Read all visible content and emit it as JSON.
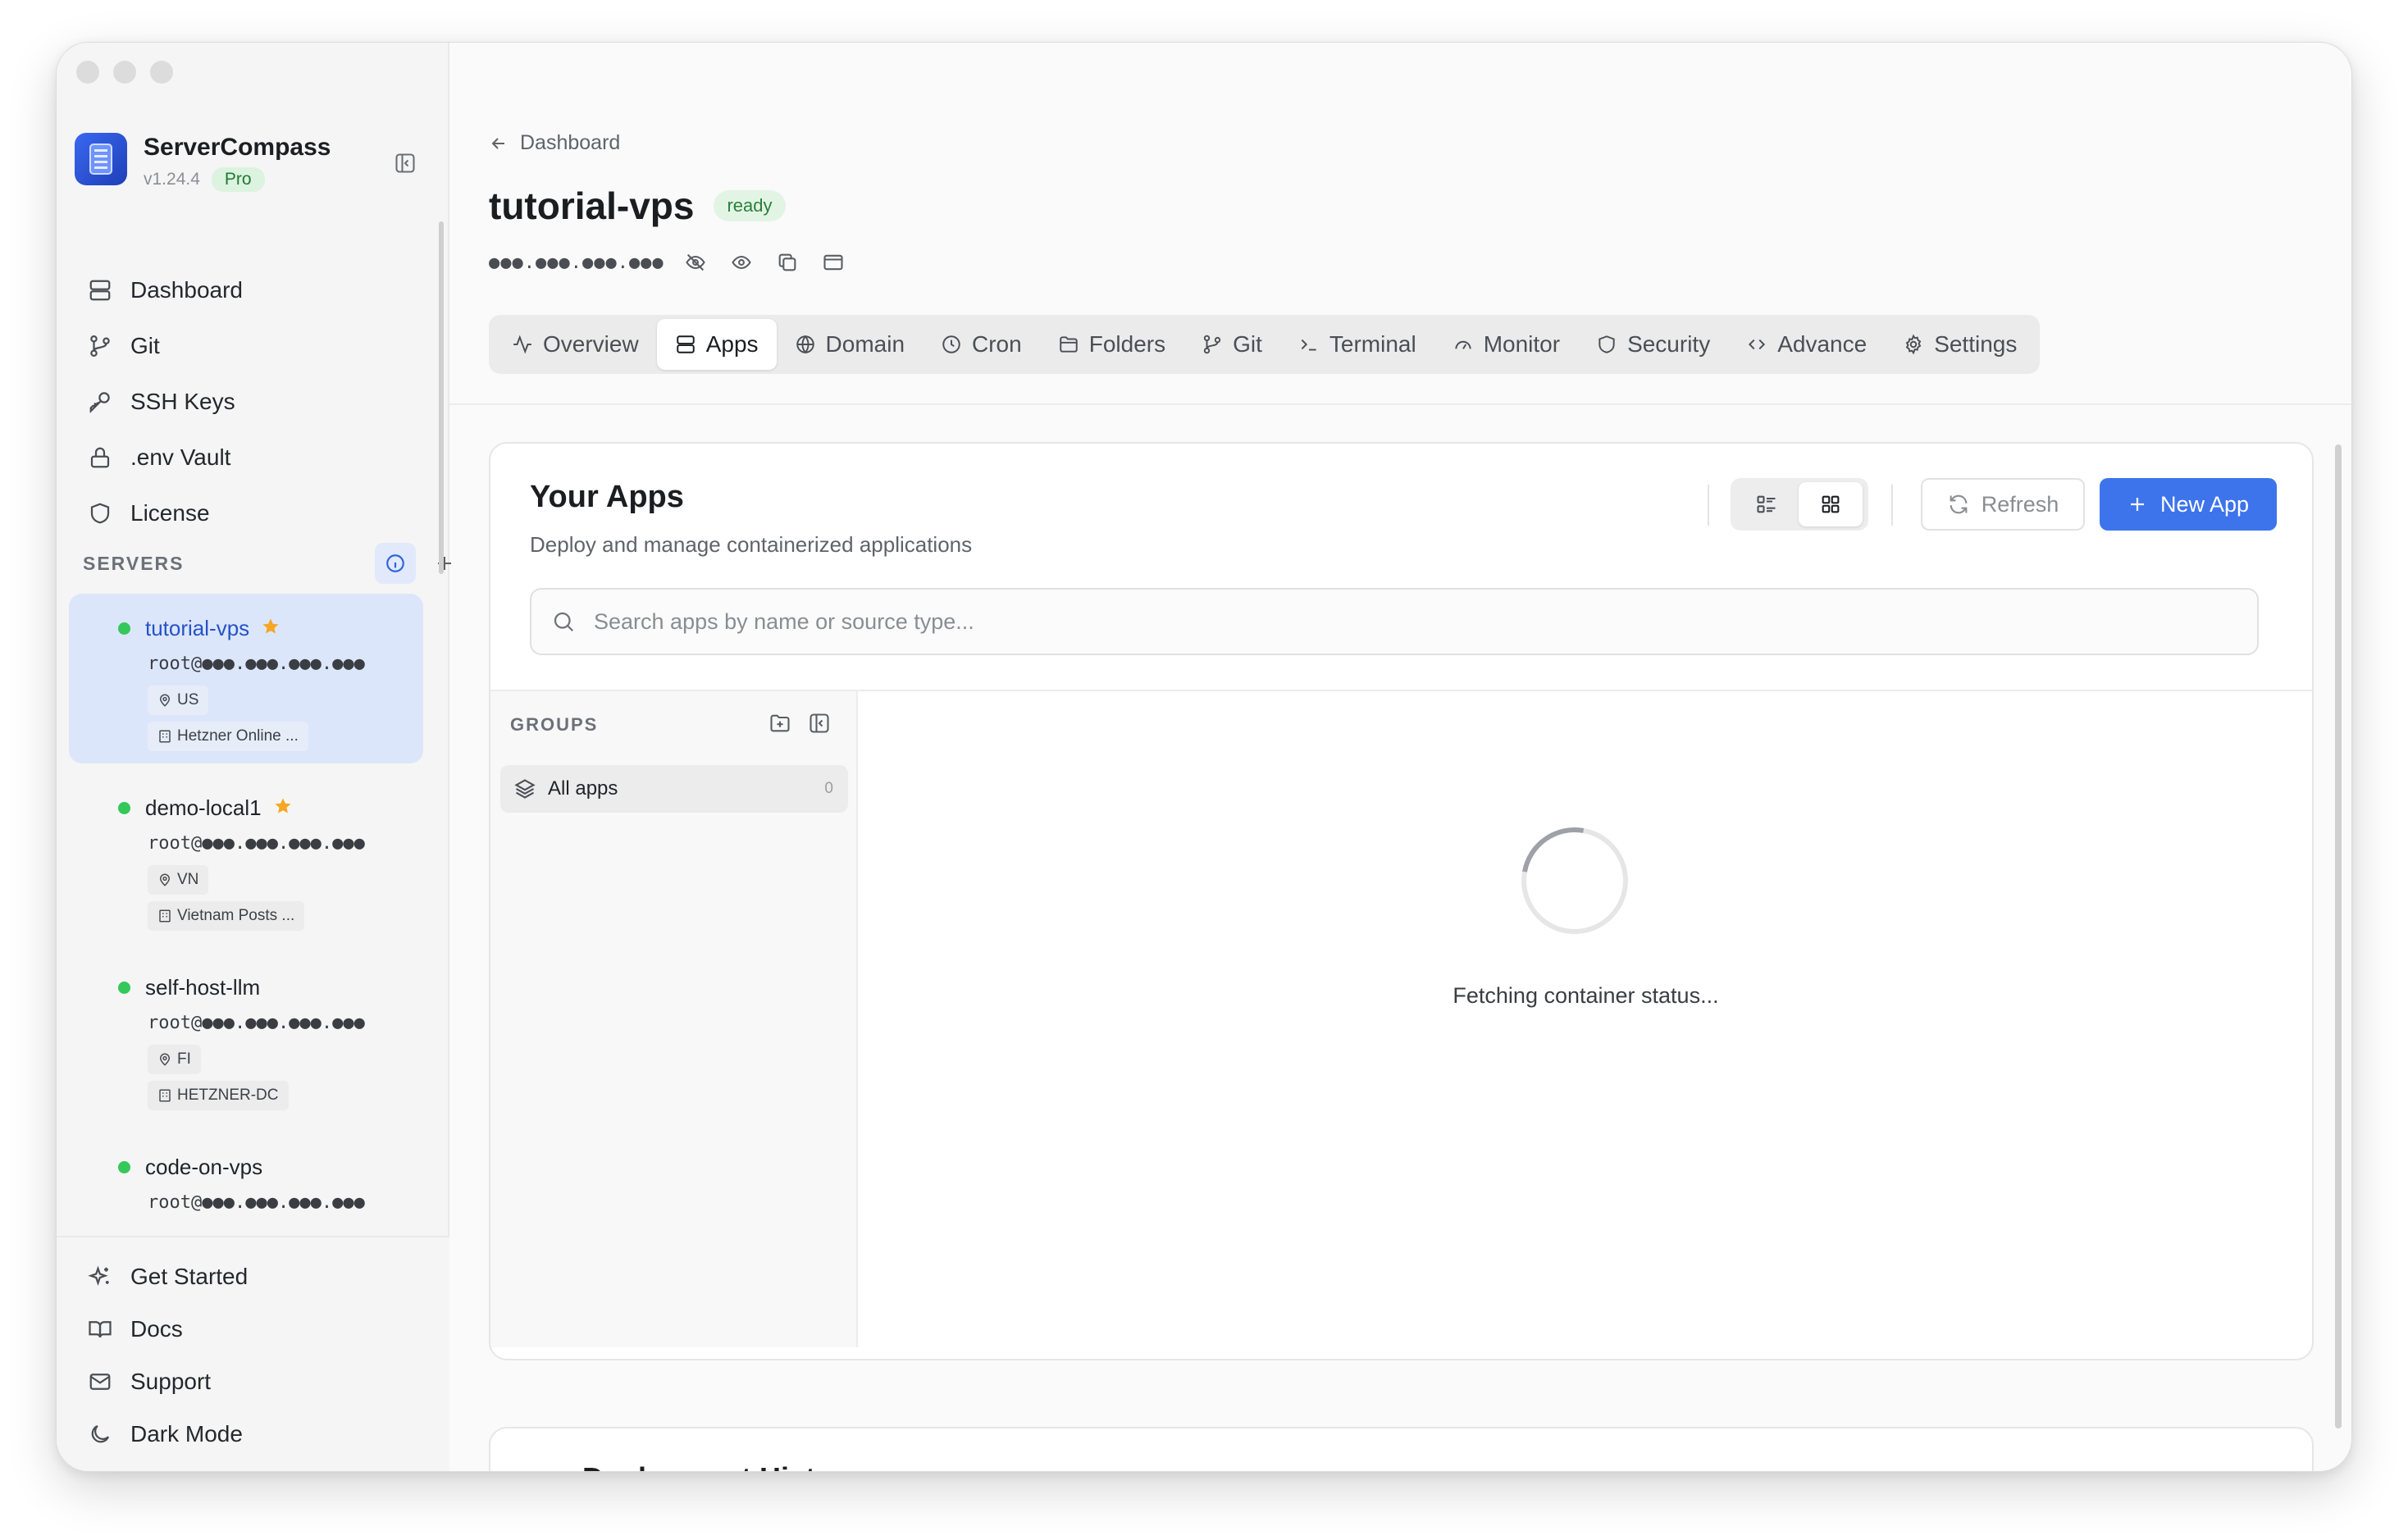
{
  "app": {
    "name": "ServerCompass",
    "version": "v1.24.4",
    "plan_badge": "Pro"
  },
  "nav": [
    {
      "label": "Dashboard",
      "icon": "server-stack-icon"
    },
    {
      "label": "Git",
      "icon": "git-branch-icon"
    },
    {
      "label": "SSH Keys",
      "icon": "key-icon"
    },
    {
      "label": ".env Vault",
      "icon": "lock-icon"
    },
    {
      "label": "License",
      "icon": "shield-icon"
    }
  ],
  "servers": {
    "title": "SERVERS",
    "items": [
      {
        "name": "tutorial-vps",
        "user": "root@●●●.●●●.●●●.●●●",
        "country": "US",
        "provider": "Hetzner Online ...",
        "favorite": true,
        "active": true,
        "status": "online"
      },
      {
        "name": "demo-local1",
        "user": "root@●●●.●●●.●●●.●●●",
        "country": "VN",
        "provider": "Vietnam Posts ...",
        "favorite": true,
        "active": false,
        "status": "online"
      },
      {
        "name": "self-host-llm",
        "user": "root@●●●.●●●.●●●.●●●",
        "country": "FI",
        "provider": "HETZNER-DC",
        "favorite": false,
        "active": false,
        "status": "online"
      },
      {
        "name": "code-on-vps",
        "user": "root@●●●.●●●.●●●.●●●",
        "country": "",
        "provider": "",
        "favorite": false,
        "active": false,
        "status": "online"
      }
    ]
  },
  "bottom_nav": [
    {
      "label": "Get Started",
      "icon": "sparkles-icon"
    },
    {
      "label": "Docs",
      "icon": "book-icon"
    },
    {
      "label": "Support",
      "icon": "mail-icon"
    },
    {
      "label": "Dark Mode",
      "icon": "moon-icon"
    }
  ],
  "breadcrumb": {
    "back_label": "Dashboard"
  },
  "server": {
    "name": "tutorial-vps",
    "status": "ready",
    "ip_masked": "●●●.●●●.●●●.●●●"
  },
  "tabs": [
    {
      "label": "Overview",
      "icon": "activity-icon"
    },
    {
      "label": "Apps",
      "icon": "server-icon",
      "active": true
    },
    {
      "label": "Domain",
      "icon": "globe-icon"
    },
    {
      "label": "Cron",
      "icon": "clock-icon"
    },
    {
      "label": "Folders",
      "icon": "folder-icon"
    },
    {
      "label": "Git",
      "icon": "git-branch-icon"
    },
    {
      "label": "Terminal",
      "icon": "terminal-icon"
    },
    {
      "label": "Monitor",
      "icon": "gauge-icon"
    },
    {
      "label": "Security",
      "icon": "shield-icon"
    },
    {
      "label": "Advance",
      "icon": "code-icon"
    },
    {
      "label": "Settings",
      "icon": "gear-icon"
    }
  ],
  "apps_panel": {
    "title": "Your Apps",
    "subtitle": "Deploy and manage containerized applications",
    "refresh_label": "Refresh",
    "new_app_label": "New App",
    "search_placeholder": "Search apps by name or source type...",
    "groups_title": "GROUPS",
    "group_all_label": "All apps",
    "group_all_count": "0",
    "loading_text": "Fetching container status..."
  },
  "deployment_history": {
    "title": "Deployment History"
  },
  "colors": {
    "accent": "#3d74ec",
    "ready_bg": "#e2f4e4",
    "online": "#34c759",
    "star": "#f5a623"
  }
}
